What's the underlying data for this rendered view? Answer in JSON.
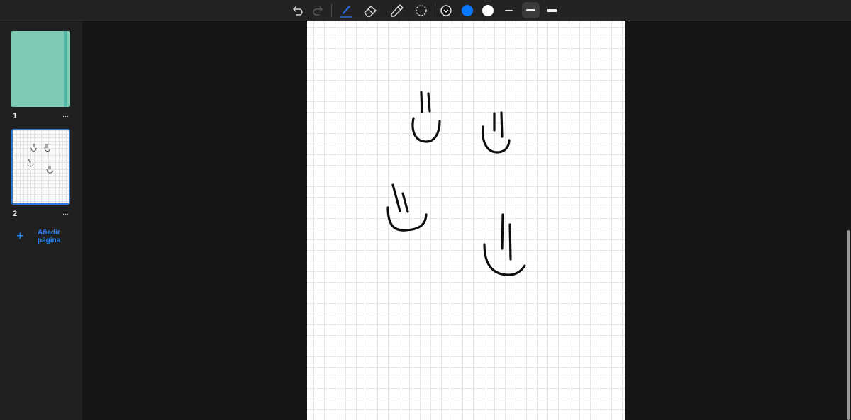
{
  "toolbar": {
    "icons": [
      "undo-icon",
      "redo-icon",
      "pen-icon",
      "eraser-icon",
      "highlighter-icon",
      "lasso-icon",
      "color-picker-icon"
    ],
    "colors": {
      "black": "#000000",
      "blue": "#0a78ff",
      "white": "#ffffff"
    },
    "selected_tool": "pen",
    "selected_weight": "medium"
  },
  "sidebar": {
    "pages": [
      {
        "number": "1",
        "more": "..."
      },
      {
        "number": "2",
        "more": "..."
      }
    ],
    "add_page": {
      "plus": "+",
      "line1": "Añadir",
      "line2": "página"
    },
    "colors": {
      "cover": "#7fcab5",
      "accent": "#2f83f0"
    }
  },
  "canvas": {
    "paper": "grid",
    "drawings": 4
  }
}
